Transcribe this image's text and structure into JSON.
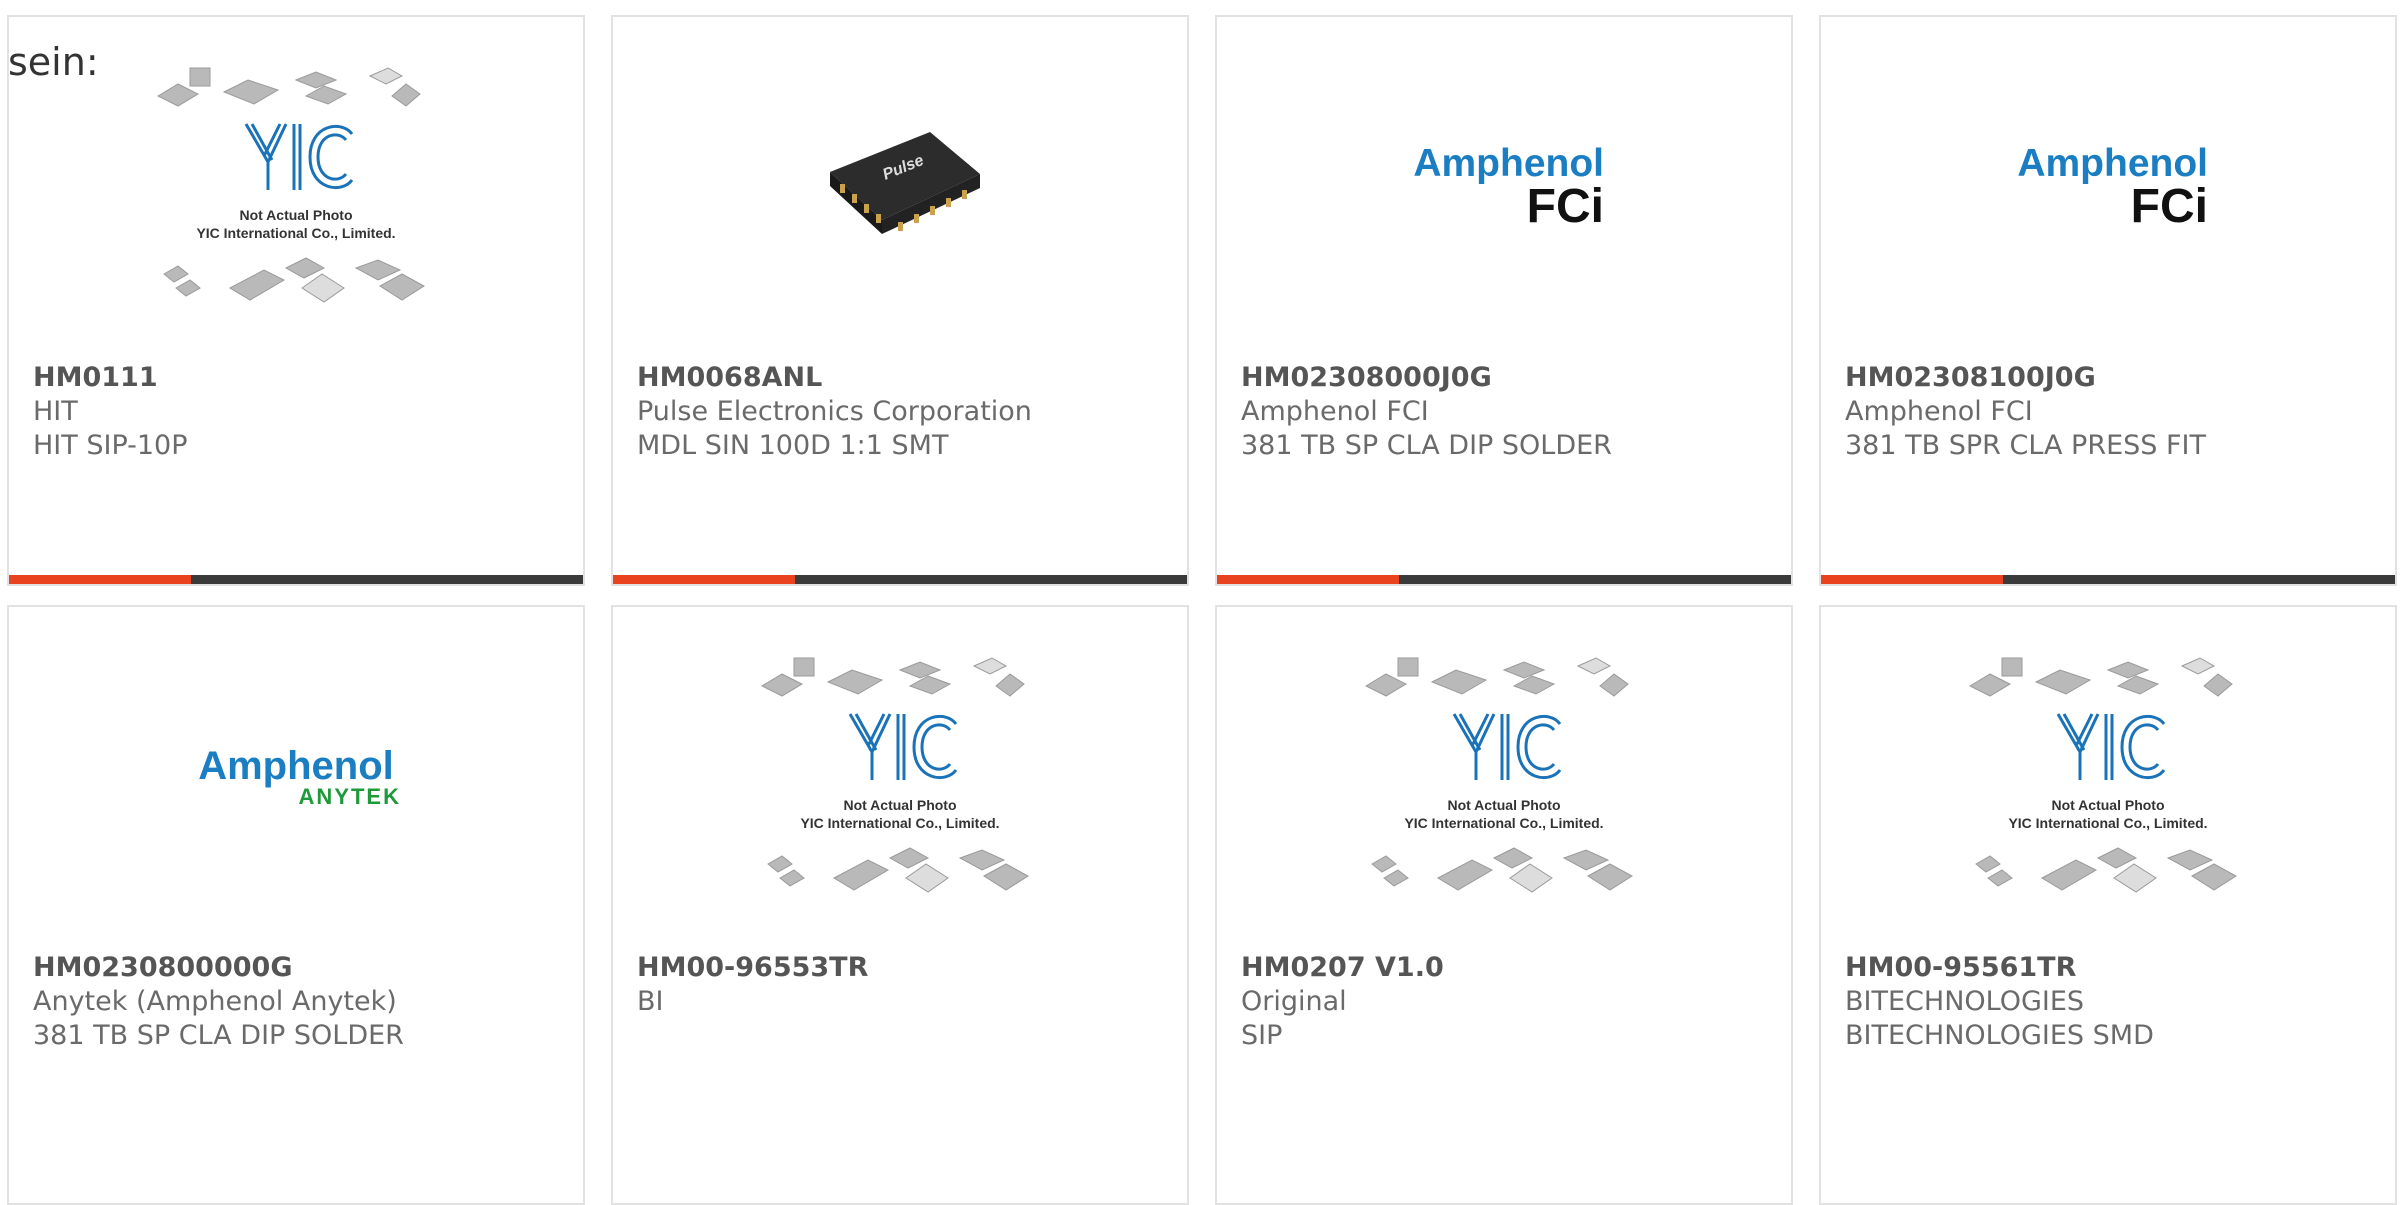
{
  "intro_text": "sein:",
  "placeholder": {
    "line1": "Not Actual Photo",
    "line2": "YIC International Co., Limited.",
    "logo": "YIC"
  },
  "products": [
    {
      "part": "HM0111",
      "manufacturer": "HIT",
      "description": "HIT SIP-10P",
      "image": "placeholder"
    },
    {
      "part": "HM0068ANL",
      "manufacturer": "Pulse Electronics Corporation",
      "description": "MDL SIN 100D 1:1 SMT",
      "image": "pulse-chip",
      "brand": "Pulse"
    },
    {
      "part": "HM02308000J0G",
      "manufacturer": "Amphenol FCI",
      "description": "381 TB SP CLA DIP SOLDER",
      "image": "amphenol-fci",
      "logo_top": "Amphenol",
      "logo_bottom": "FCi"
    },
    {
      "part": "HM02308100J0G",
      "manufacturer": "Amphenol FCI",
      "description": "381 TB SPR CLA PRESS FIT",
      "image": "amphenol-fci",
      "logo_top": "Amphenol",
      "logo_bottom": "FCi"
    },
    {
      "part": "HM0230800000G",
      "manufacturer": "Anytek (Amphenol Anytek)",
      "description": "381 TB SP CLA DIP SOLDER",
      "image": "amphenol-anytek",
      "logo_top": "Amphenol",
      "logo_bottom": "ANYTEK"
    },
    {
      "part": "HM00-96553TR",
      "manufacturer": "BI",
      "description": "",
      "image": "placeholder"
    },
    {
      "part": "HM0207 V1.0",
      "manufacturer": "Original",
      "description": "SIP",
      "image": "placeholder"
    },
    {
      "part": "HM00-95561TR",
      "manufacturer": "BITECHNOLOGIES",
      "description": "BITECHNOLOGIES SMD",
      "image": "placeholder"
    }
  ],
  "colors": {
    "accent": "#e8421e",
    "bar": "#3a3a3a",
    "amphenol_blue": "#1c7ec2",
    "anytek_green": "#1f9a3a",
    "yic_blue": "#1a73b8"
  }
}
